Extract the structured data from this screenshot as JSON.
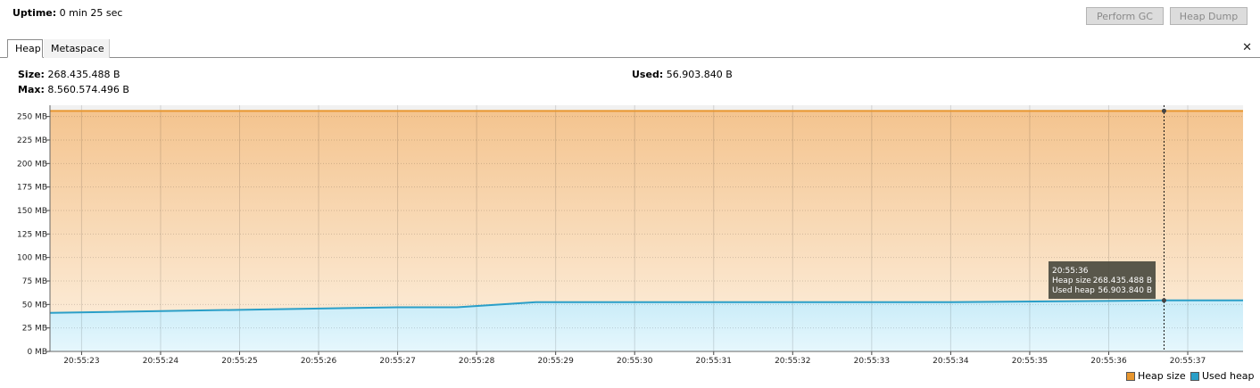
{
  "header": {
    "uptime_label": "Uptime:",
    "uptime_value": "0 min 25 sec",
    "perform_gc_label": "Perform GC",
    "heap_dump_label": "Heap Dump"
  },
  "tabs": [
    {
      "label": "Heap",
      "active": true
    },
    {
      "label": "Metaspace",
      "active": false
    }
  ],
  "close_icon": "close-icon",
  "stats": {
    "size_label": "Size:",
    "size_value": "268.435.488 B",
    "max_label": "Max:",
    "max_value": "8.560.574.496 B",
    "used_label": "Used:",
    "used_value": "56.903.840 B"
  },
  "colors": {
    "heap_size": "#e8962e",
    "used_heap": "#2a9fc8"
  },
  "chart_data": {
    "type": "area",
    "y_unit": "MB",
    "ylim": [
      0,
      262
    ],
    "y_ticks": [
      0,
      25,
      50,
      75,
      100,
      125,
      150,
      175,
      200,
      225,
      250
    ],
    "y_tick_labels": [
      "0 MB",
      "25 MB",
      "50 MB",
      "75 MB",
      "100 MB",
      "125 MB",
      "150 MB",
      "175 MB",
      "200 MB",
      "225 MB",
      "250 MB"
    ],
    "x_unit": "seconds",
    "xlim": [
      22.6,
      37.7
    ],
    "x_ticks": [
      23,
      24,
      25,
      26,
      27,
      28,
      29,
      30,
      31,
      32,
      33,
      34,
      35,
      36,
      37
    ],
    "x_tick_labels": [
      "20:55:23",
      "20:55:24",
      "20:55:25",
      "20:55:26",
      "20:55:27",
      "20:55:28",
      "20:55:29",
      "20:55:30",
      "20:55:31",
      "20:55:32",
      "20:55:33",
      "20:55:34",
      "20:55:35",
      "20:55:36",
      "20:55:37"
    ],
    "grid": true,
    "legend_position": "bottom-right",
    "series": [
      {
        "name": "Heap size",
        "x": [
          22.6,
          37.7
        ],
        "values": [
          256,
          256
        ]
      },
      {
        "name": "Used heap",
        "x": [
          22.6,
          25.0,
          27.0,
          27.75,
          28.75,
          34.0,
          36.7,
          37.7
        ],
        "values": [
          41.0,
          44.3,
          47.0,
          47.0,
          52.5,
          52.5,
          54.3,
          54.3
        ]
      }
    ],
    "cursor": {
      "x": 36.7,
      "time_label": "20:55:36",
      "rows": [
        {
          "label": "Heap size",
          "value": "268.435.488 B"
        },
        {
          "label": "Used heap",
          "value": "56.903.840 B"
        }
      ]
    }
  }
}
